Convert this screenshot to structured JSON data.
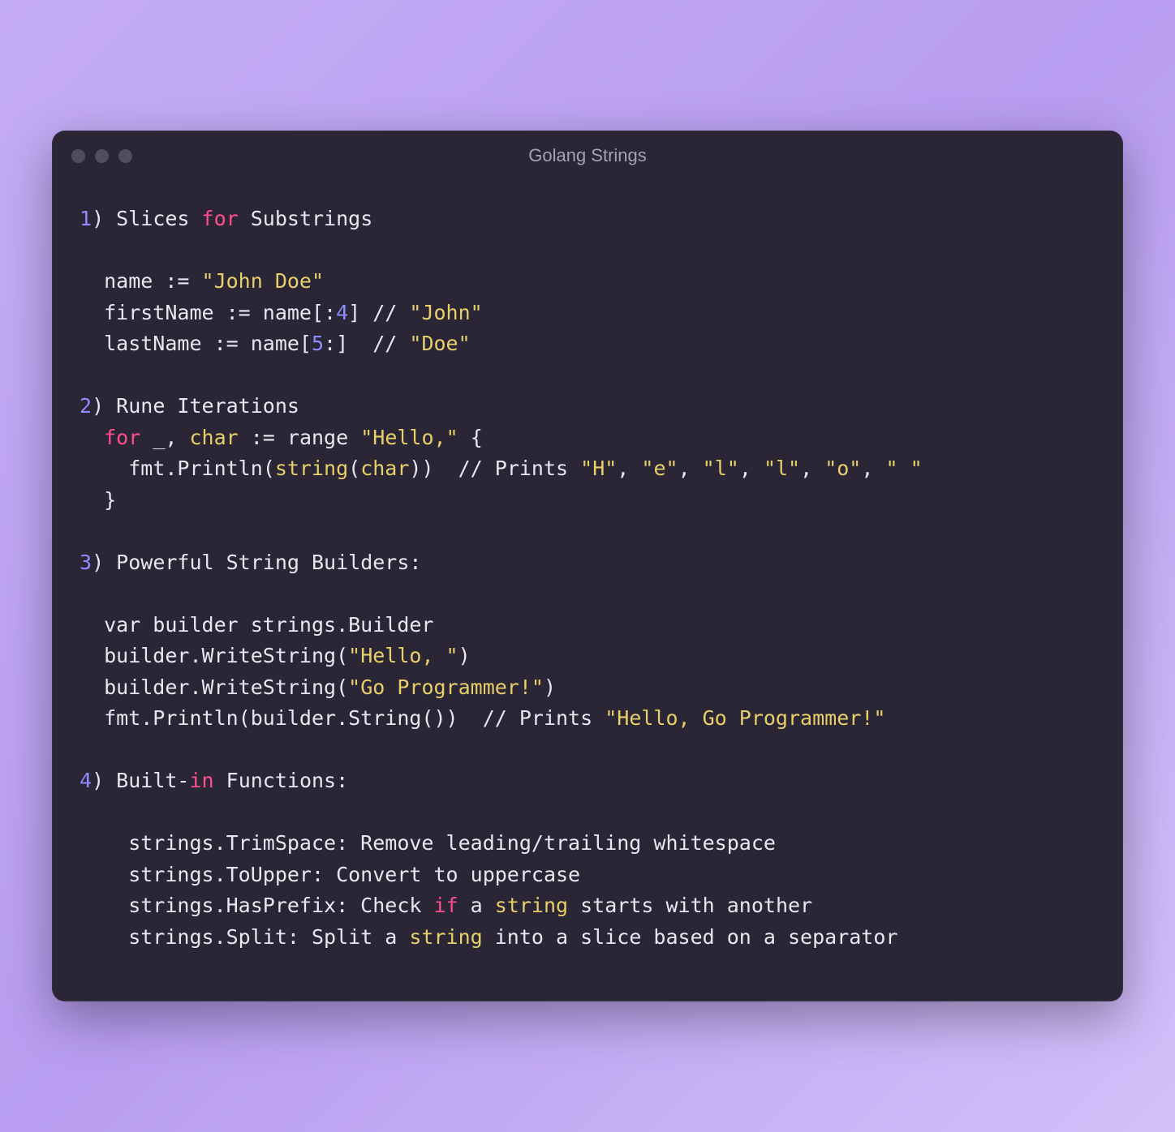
{
  "window": {
    "title": "Golang Strings"
  },
  "code": {
    "lines": [
      [
        {
          "c": "num",
          "t": "1"
        },
        {
          "c": "plain",
          "t": ") Slices "
        },
        {
          "c": "kw",
          "t": "for"
        },
        {
          "c": "plain",
          "t": " Substrings"
        }
      ],
      [],
      [
        {
          "c": "plain",
          "t": "  name := "
        },
        {
          "c": "str",
          "t": "\"John Doe\""
        }
      ],
      [
        {
          "c": "plain",
          "t": "  firstName := name[:"
        },
        {
          "c": "num",
          "t": "4"
        },
        {
          "c": "plain",
          "t": "] // "
        },
        {
          "c": "str",
          "t": "\"John\""
        }
      ],
      [
        {
          "c": "plain",
          "t": "  lastName := name["
        },
        {
          "c": "num",
          "t": "5"
        },
        {
          "c": "plain",
          "t": ":]  // "
        },
        {
          "c": "str",
          "t": "\"Doe\""
        }
      ],
      [],
      [
        {
          "c": "num",
          "t": "2"
        },
        {
          "c": "plain",
          "t": ") Rune Iterations"
        }
      ],
      [
        {
          "c": "plain",
          "t": "  "
        },
        {
          "c": "kw",
          "t": "for"
        },
        {
          "c": "plain",
          "t": " _, "
        },
        {
          "c": "type",
          "t": "char"
        },
        {
          "c": "plain",
          "t": " := range "
        },
        {
          "c": "str",
          "t": "\"Hello,\""
        },
        {
          "c": "plain",
          "t": " {"
        }
      ],
      [
        {
          "c": "plain",
          "t": "    fmt.Println("
        },
        {
          "c": "type",
          "t": "string"
        },
        {
          "c": "plain",
          "t": "("
        },
        {
          "c": "type",
          "t": "char"
        },
        {
          "c": "plain",
          "t": "))  // Prints "
        },
        {
          "c": "str",
          "t": "\"H\""
        },
        {
          "c": "plain",
          "t": ", "
        },
        {
          "c": "str",
          "t": "\"e\""
        },
        {
          "c": "plain",
          "t": ", "
        },
        {
          "c": "str",
          "t": "\"l\""
        },
        {
          "c": "plain",
          "t": ", "
        },
        {
          "c": "str",
          "t": "\"l\""
        },
        {
          "c": "plain",
          "t": ", "
        },
        {
          "c": "str",
          "t": "\"o\""
        },
        {
          "c": "plain",
          "t": ", "
        },
        {
          "c": "str",
          "t": "\" \""
        }
      ],
      [
        {
          "c": "plain",
          "t": "  }"
        }
      ],
      [],
      [
        {
          "c": "num",
          "t": "3"
        },
        {
          "c": "plain",
          "t": ") Powerful String Builders:"
        }
      ],
      [],
      [
        {
          "c": "plain",
          "t": "  var builder strings.Builder"
        }
      ],
      [
        {
          "c": "plain",
          "t": "  builder.WriteString("
        },
        {
          "c": "str",
          "t": "\"Hello, \""
        },
        {
          "c": "plain",
          "t": ")"
        }
      ],
      [
        {
          "c": "plain",
          "t": "  builder.WriteString("
        },
        {
          "c": "str",
          "t": "\"Go Programmer!\""
        },
        {
          "c": "plain",
          "t": ")"
        }
      ],
      [
        {
          "c": "plain",
          "t": "  fmt.Println(builder.String())  // Prints "
        },
        {
          "c": "str",
          "t": "\"Hello, Go Programmer!\""
        }
      ],
      [],
      [
        {
          "c": "num",
          "t": "4"
        },
        {
          "c": "plain",
          "t": ") Built-"
        },
        {
          "c": "kw",
          "t": "in"
        },
        {
          "c": "plain",
          "t": " Functions:"
        }
      ],
      [],
      [
        {
          "c": "plain",
          "t": "    strings.TrimSpace: Remove leading/trailing whitespace"
        }
      ],
      [
        {
          "c": "plain",
          "t": "    strings.ToUpper: Convert to uppercase"
        }
      ],
      [
        {
          "c": "plain",
          "t": "    strings.HasPrefix: Check "
        },
        {
          "c": "kw",
          "t": "if"
        },
        {
          "c": "plain",
          "t": " a "
        },
        {
          "c": "type",
          "t": "string"
        },
        {
          "c": "plain",
          "t": " starts with another"
        }
      ],
      [
        {
          "c": "plain",
          "t": "    strings.Split: Split a "
        },
        {
          "c": "type",
          "t": "string"
        },
        {
          "c": "plain",
          "t": " into a slice based on a separator"
        }
      ]
    ]
  }
}
